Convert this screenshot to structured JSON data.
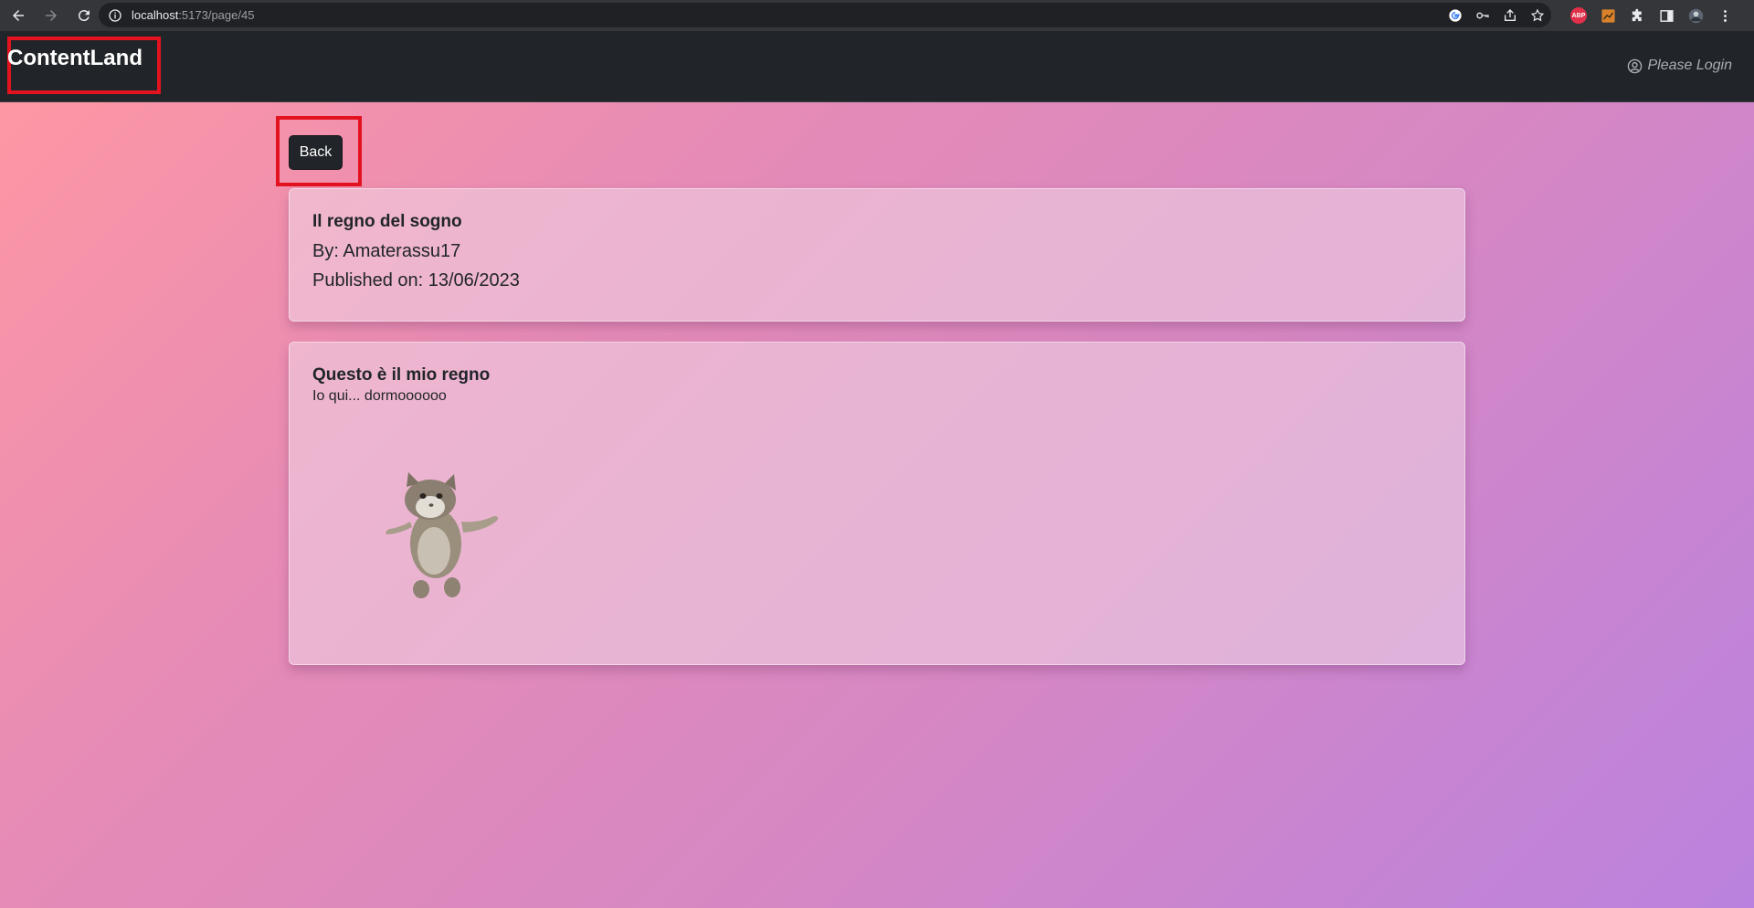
{
  "browser": {
    "url_host": "localhost",
    "url_path": ":5173/page/45",
    "extensions": {
      "abp_label": "ABP"
    }
  },
  "navbar": {
    "brand": "ContentLand",
    "login_label": "Please Login"
  },
  "page": {
    "back_label": "Back",
    "info_card": {
      "title": "Il regno del sogno",
      "author_line": "By: Amaterassu17",
      "published_line": "Published on: 13/06/2023"
    },
    "content_card": {
      "title": "Questo è il mio regno",
      "text": "Io qui... dormoooooo"
    }
  },
  "colors": {
    "highlight_border": "#e3121f",
    "navbar_bg": "#212529",
    "gradient_start": "#fe97a4",
    "gradient_end": "#ba82de"
  }
}
